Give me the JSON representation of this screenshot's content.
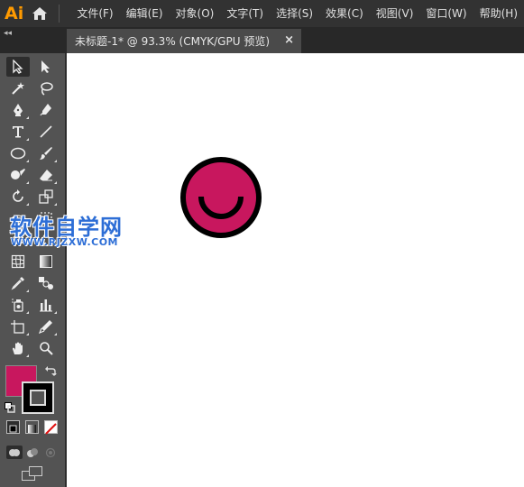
{
  "app": {
    "logo_text": "Ai"
  },
  "menu": {
    "items": [
      "文件(F)",
      "编辑(E)",
      "对象(O)",
      "文字(T)",
      "选择(S)",
      "效果(C)",
      "视图(V)",
      "窗口(W)",
      "帮助(H)"
    ]
  },
  "tabstrip": {
    "collapse_glyph": "◂◂"
  },
  "document_tab": {
    "title": "未标题-1* @ 93.3% (CMYK/GPU 预览)",
    "close_glyph": "×"
  },
  "toolbar": {
    "fill_color": "#c8175e",
    "stroke_color": "#000000",
    "tools": [
      "selection-tool",
      "direct-selection-tool",
      "magic-wand-tool",
      "lasso-tool",
      "pen-tool",
      "curvature-tool",
      "type-tool",
      "line-segment-tool",
      "ellipse-tool",
      "paintbrush-tool",
      "shaper-tool",
      "eraser-tool",
      "rotate-tool",
      "scale-tool",
      "mesh-tool",
      "gradient-tool",
      "eyedropper-tool",
      "blend-tool",
      "symbol-sprayer-tool",
      "column-graph-tool",
      "artboard-tool",
      "slice-tool",
      "hand-tool",
      "zoom-tool"
    ]
  },
  "artwork": {
    "face_color": "#c8175e",
    "outline_color": "#000000"
  },
  "watermark": {
    "title": "软件自学网",
    "url": "WWW.RJZXW.COM"
  }
}
